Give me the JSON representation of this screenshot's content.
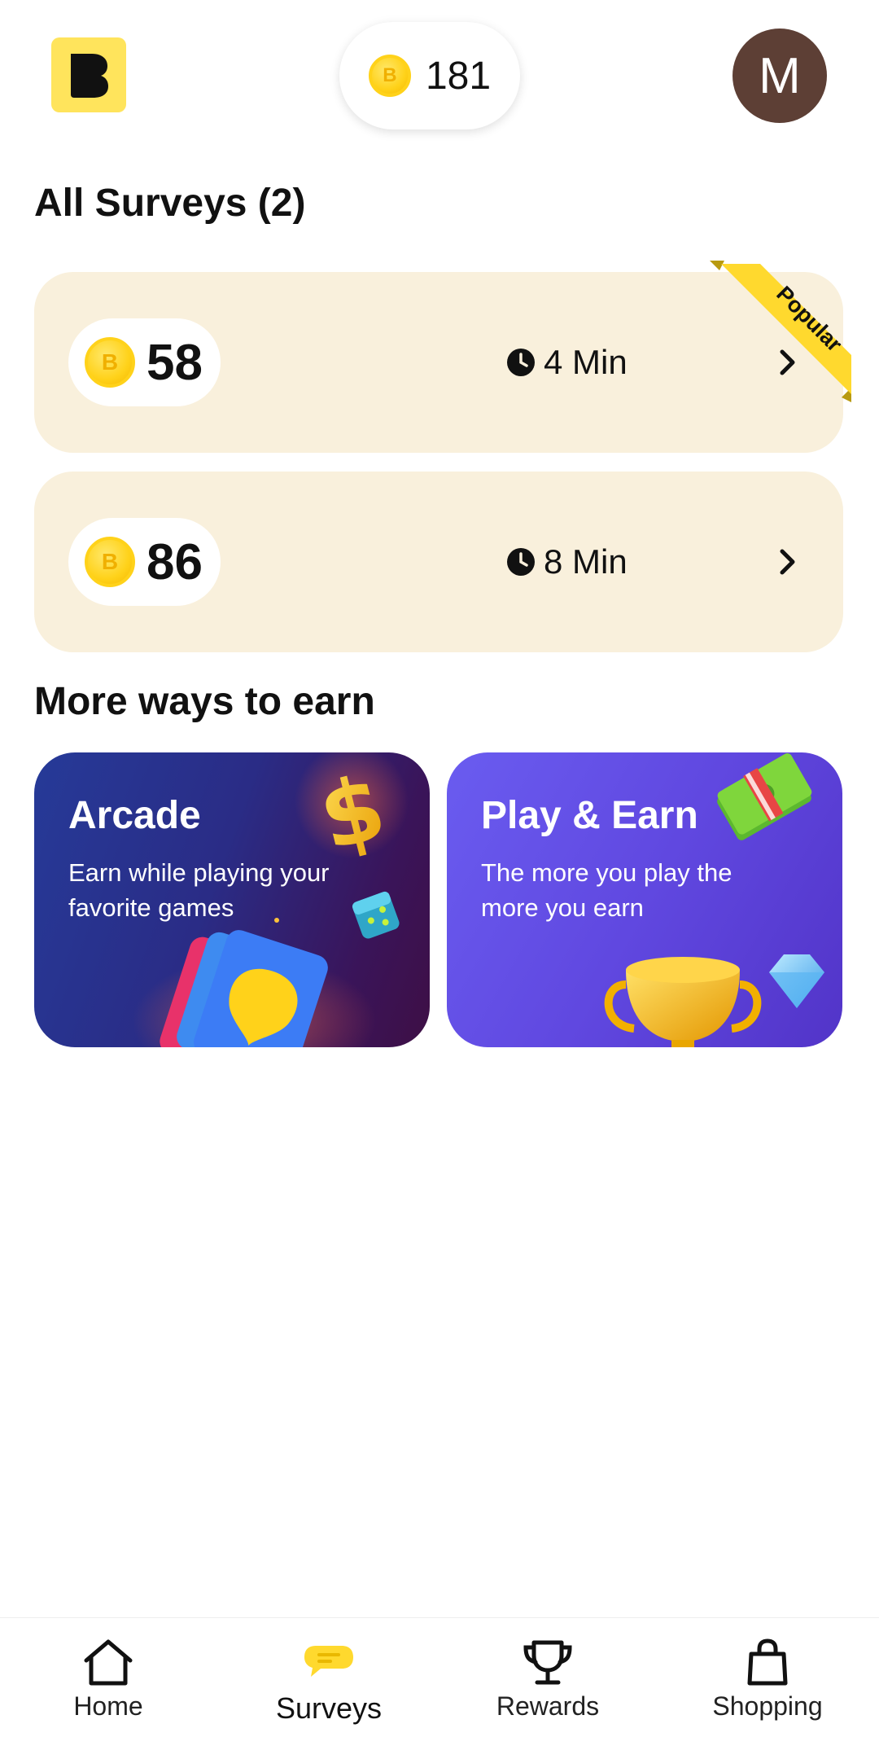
{
  "header": {
    "balance": "181",
    "avatar_initial": "M"
  },
  "surveys": {
    "title": "All Surveys (2)",
    "items": [
      {
        "reward": "58",
        "duration": "4 Min",
        "badge": "Popular"
      },
      {
        "reward": "86",
        "duration": "8 Min"
      }
    ]
  },
  "more": {
    "title": "More ways to earn",
    "cards": [
      {
        "title": "Arcade",
        "description": "Earn while playing your favorite games"
      },
      {
        "title": "Play & Earn",
        "description": "The more you play the more you earn"
      }
    ]
  },
  "nav": {
    "items": [
      {
        "label": "Home",
        "icon": "home-icon"
      },
      {
        "label": "Surveys",
        "icon": "chat-bubble-icon",
        "active": true
      },
      {
        "label": "Rewards",
        "icon": "trophy-icon"
      },
      {
        "label": "Shopping",
        "icon": "shopping-bag-icon"
      }
    ]
  },
  "colors": {
    "brand_yellow": "#FFE45C",
    "survey_card_bg": "#F9F0DC",
    "avatar_bg": "#5D3F35",
    "arcade_bg": "#2A2C86",
    "play_earn_bg": "#6048E0"
  }
}
